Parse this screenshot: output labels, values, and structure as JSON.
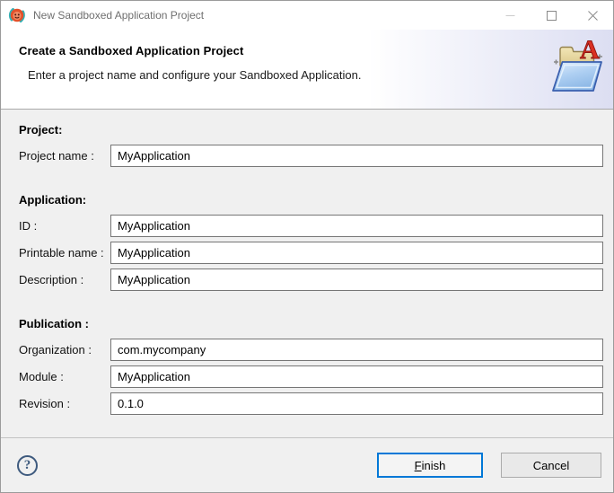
{
  "window": {
    "title": "New Sandboxed Application Project",
    "controls": {
      "minimize": "minimize",
      "maximize": "maximize",
      "close": "close"
    }
  },
  "banner": {
    "title": "Create a Sandboxed Application Project",
    "subtitle": "Enter a project name and configure your Sandboxed Application."
  },
  "form": {
    "sections": [
      {
        "heading": "Project:",
        "fields": [
          {
            "label": "Project name :",
            "value": "MyApplication"
          }
        ]
      },
      {
        "heading": "Application:",
        "fields": [
          {
            "label": "ID :",
            "value": "MyApplication"
          },
          {
            "label": "Printable name :",
            "value": "MyApplication"
          },
          {
            "label": "Description :",
            "value": "MyApplication"
          }
        ]
      },
      {
        "heading": "Publication :",
        "fields": [
          {
            "label": "Organization :",
            "value": "com.mycompany"
          },
          {
            "label": "Module :",
            "value": "MyApplication"
          },
          {
            "label": "Revision :",
            "value": "0.1.0"
          }
        ]
      }
    ]
  },
  "footer": {
    "help": "?",
    "finish": {
      "mnemonic": "F",
      "rest": "inish"
    },
    "cancel_label": "Cancel"
  },
  "colors": {
    "accent_blue": "#0078d7",
    "window_border": "#9b9b9b",
    "content_bg": "#f0f0f0",
    "banner_gradient_end": "#dcdef2",
    "title_text": "#6f6f6f",
    "input_border": "#767676",
    "help_icon": "#3e5a7e",
    "letter_a_red": "#d93022",
    "folder_front_blue": "#a9cdf0",
    "folder_back_tan": "#ead9a2",
    "app_icon_orange": "#e4502a",
    "app_icon_teal": "#35b0b4"
  }
}
